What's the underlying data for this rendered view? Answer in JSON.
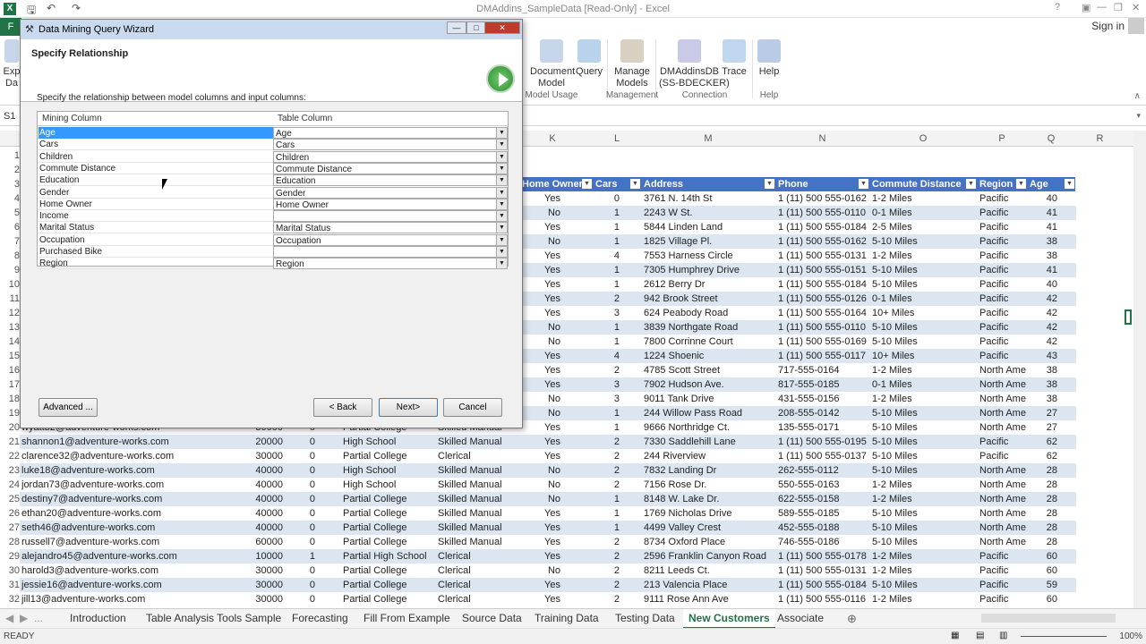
{
  "title": "DMAddins_SampleData  [Read-Only] - Excel",
  "signin": "Sign in",
  "file_tab": "F",
  "ribbon": {
    "buttons": [
      {
        "label": "Exp\nDa",
        "icon": "export-data-icon"
      },
      {
        "label": "Document\nModel",
        "icon": "document-model-icon"
      },
      {
        "label": "Query",
        "icon": "query-icon"
      },
      {
        "label": "Manage\nModels",
        "icon": "manage-models-icon"
      },
      {
        "label": "DMAddinsDB\n(SS-BDECKER)",
        "icon": "connection-icon"
      },
      {
        "label": "Trace",
        "icon": "trace-icon"
      },
      {
        "label": "Help",
        "icon": "help-icon"
      }
    ],
    "groups": [
      "Model Usage",
      "Management",
      "Connection",
      "Help"
    ]
  },
  "namebox": "S1",
  "columns": [
    "K",
    "L",
    "M",
    "N",
    "O",
    "P",
    "Q",
    "R"
  ],
  "rownums": [
    "1",
    "2",
    "3",
    "4",
    "5",
    "6",
    "7",
    "8",
    "9",
    "10",
    "11",
    "12",
    "13",
    "14",
    "15",
    "16",
    "17",
    "18",
    "19",
    "20",
    "21",
    "22",
    "23",
    "24",
    "25",
    "26",
    "27",
    "28",
    "29",
    "30",
    "31",
    "32"
  ],
  "table_headers": [
    "Home Owner",
    "Cars",
    "Address",
    "Phone",
    "Commute Distance",
    "Region",
    "Age"
  ],
  "rows_right": [
    [
      "Yes",
      "0",
      "3761 N. 14th St",
      "1 (11) 500 555-0162",
      "1-2 Miles",
      "Pacific",
      "40"
    ],
    [
      "No",
      "1",
      "2243 W St.",
      "1 (11) 500 555-0110",
      "0-1 Miles",
      "Pacific",
      "41"
    ],
    [
      "Yes",
      "1",
      "5844 Linden Land",
      "1 (11) 500 555-0184",
      "2-5 Miles",
      "Pacific",
      "41"
    ],
    [
      "No",
      "1",
      "1825 Village Pl.",
      "1 (11) 500 555-0162",
      "5-10 Miles",
      "Pacific",
      "38"
    ],
    [
      "Yes",
      "4",
      "7553 Harness Circle",
      "1 (11) 500 555-0131",
      "1-2 Miles",
      "Pacific",
      "38"
    ],
    [
      "Yes",
      "1",
      "7305 Humphrey Drive",
      "1 (11) 500 555-0151",
      "5-10 Miles",
      "Pacific",
      "41"
    ],
    [
      "Yes",
      "1",
      "2612 Berry Dr",
      "1 (11) 500 555-0184",
      "5-10 Miles",
      "Pacific",
      "40"
    ],
    [
      "Yes",
      "2",
      "942 Brook Street",
      "1 (11) 500 555-0126",
      "0-1 Miles",
      "Pacific",
      "42"
    ],
    [
      "Yes",
      "3",
      "624 Peabody Road",
      "1 (11) 500 555-0164",
      "10+ Miles",
      "Pacific",
      "42"
    ],
    [
      "No",
      "1",
      "3839 Northgate Road",
      "1 (11) 500 555-0110",
      "5-10 Miles",
      "Pacific",
      "42"
    ],
    [
      "No",
      "1",
      "7800 Corrinne Court",
      "1 (11) 500 555-0169",
      "5-10 Miles",
      "Pacific",
      "42"
    ],
    [
      "Yes",
      "4",
      "1224 Shoenic",
      "1 (11) 500 555-0117",
      "10+ Miles",
      "Pacific",
      "43"
    ],
    [
      "Yes",
      "2",
      "4785 Scott Street",
      "717-555-0164",
      "1-2 Miles",
      "North Ame",
      "38"
    ],
    [
      "Yes",
      "3",
      "7902 Hudson Ave.",
      "817-555-0185",
      "0-1 Miles",
      "North Ame",
      "38"
    ],
    [
      "No",
      "3",
      "9011 Tank Drive",
      "431-555-0156",
      "1-2 Miles",
      "North Ame",
      "38"
    ],
    [
      "No",
      "1",
      "244 Willow Pass Road",
      "208-555-0142",
      "5-10 Miles",
      "North Ame",
      "27"
    ],
    [
      "Yes",
      "1",
      "9666 Northridge Ct.",
      "135-555-0171",
      "5-10 Miles",
      "North Ame",
      "27"
    ],
    [
      "Yes",
      "2",
      "7330 Saddlehill Lane",
      "1 (11) 500 555-0195",
      "5-10 Miles",
      "Pacific",
      "62"
    ],
    [
      "Yes",
      "2",
      "244 Riverview",
      "1 (11) 500 555-0137",
      "5-10 Miles",
      "Pacific",
      "62"
    ],
    [
      "No",
      "2",
      "7832 Landing Dr",
      "262-555-0112",
      "5-10 Miles",
      "North Ame",
      "28"
    ],
    [
      "No",
      "2",
      "7156 Rose Dr.",
      "550-555-0163",
      "1-2 Miles",
      "North Ame",
      "28"
    ],
    [
      "No",
      "1",
      "8148 W. Lake Dr.",
      "622-555-0158",
      "1-2 Miles",
      "North Ame",
      "28"
    ],
    [
      "Yes",
      "1",
      "1769 Nicholas Drive",
      "589-555-0185",
      "5-10 Miles",
      "North Ame",
      "28"
    ],
    [
      "Yes",
      "1",
      "4499 Valley Crest",
      "452-555-0188",
      "5-10 Miles",
      "North Ame",
      "28"
    ],
    [
      "Yes",
      "2",
      "8734 Oxford Place",
      "746-555-0186",
      "5-10 Miles",
      "North Ame",
      "28"
    ],
    [
      "Yes",
      "2",
      "2596 Franklin Canyon Road",
      "1 (11) 500 555-0178",
      "1-2 Miles",
      "Pacific",
      "60"
    ],
    [
      "No",
      "2",
      "8211 Leeds Ct.",
      "1 (11) 500 555-0131",
      "1-2 Miles",
      "Pacific",
      "60"
    ],
    [
      "Yes",
      "2",
      "213 Valencia Place",
      "1 (11) 500 555-0184",
      "5-10 Miles",
      "Pacific",
      "59"
    ],
    [
      "Yes",
      "2",
      "9111 Rose Ann Ave",
      "1 (11) 500 555-0116",
      "1-2 Miles",
      "Pacific",
      "60"
    ]
  ],
  "rows_left": [
    [
      "wyatt32@adventure-works.com",
      "30000",
      "0",
      "Partial College",
      "Skilled Manual"
    ],
    [
      "shannon1@adventure-works.com",
      "20000",
      "0",
      "High School",
      "Skilled Manual"
    ],
    [
      "clarence32@adventure-works.com",
      "30000",
      "0",
      "Partial College",
      "Clerical"
    ],
    [
      "luke18@adventure-works.com",
      "40000",
      "0",
      "High School",
      "Skilled Manual"
    ],
    [
      "jordan73@adventure-works.com",
      "40000",
      "0",
      "High School",
      "Skilled Manual"
    ],
    [
      "destiny7@adventure-works.com",
      "40000",
      "0",
      "Partial College",
      "Skilled Manual"
    ],
    [
      "ethan20@adventure-works.com",
      "40000",
      "0",
      "Partial College",
      "Skilled Manual"
    ],
    [
      "seth46@adventure-works.com",
      "40000",
      "0",
      "Partial College",
      "Skilled Manual"
    ],
    [
      "russell7@adventure-works.com",
      "60000",
      "0",
      "Partial College",
      "Skilled Manual"
    ],
    [
      "alejandro45@adventure-works.com",
      "10000",
      "1",
      "Partial High School",
      "Clerical"
    ],
    [
      "harold3@adventure-works.com",
      "30000",
      "0",
      "Partial College",
      "Clerical"
    ],
    [
      "jessie16@adventure-works.com",
      "30000",
      "0",
      "Partial College",
      "Clerical"
    ],
    [
      "jill13@adventure-works.com",
      "30000",
      "0",
      "Partial College",
      "Clerical"
    ]
  ],
  "sheet_tabs": [
    "Introduction",
    "Table Analysis Tools Sample",
    "Forecasting",
    "Fill From Example",
    "Source Data",
    "Training Data",
    "Testing Data",
    "New Customers",
    "Associate"
  ],
  "active_tab": "New Customers",
  "status": "READY",
  "zoom": "100%",
  "dialog": {
    "title": "Data Mining Query Wizard",
    "heading": "Specify Relationship",
    "instruction": "Specify the relationship between model columns and input columns:",
    "col_mining": "Mining Column",
    "col_table": "Table Column",
    "rows": [
      {
        "mining": "Age",
        "table": "Age"
      },
      {
        "mining": "Cars",
        "table": "Cars"
      },
      {
        "mining": "Children",
        "table": "Children"
      },
      {
        "mining": "Commute Distance",
        "table": "Commute Distance"
      },
      {
        "mining": "Education",
        "table": "Education"
      },
      {
        "mining": "Gender",
        "table": "Gender"
      },
      {
        "mining": "Home Owner",
        "table": "Home Owner"
      },
      {
        "mining": "Income",
        "table": ""
      },
      {
        "mining": "Marital Status",
        "table": "Marital Status"
      },
      {
        "mining": "Occupation",
        "table": "Occupation"
      },
      {
        "mining": "Purchased Bike",
        "table": ""
      },
      {
        "mining": "Region",
        "table": "Region"
      }
    ],
    "btn_advanced": "Advanced ...",
    "btn_back": "< Back",
    "btn_next": "Next>",
    "btn_cancel": "Cancel"
  },
  "colors": {
    "excel_green": "#217346",
    "table_header": "#4472c4",
    "band": "#dce6f1",
    "selection": "#3399ff"
  }
}
